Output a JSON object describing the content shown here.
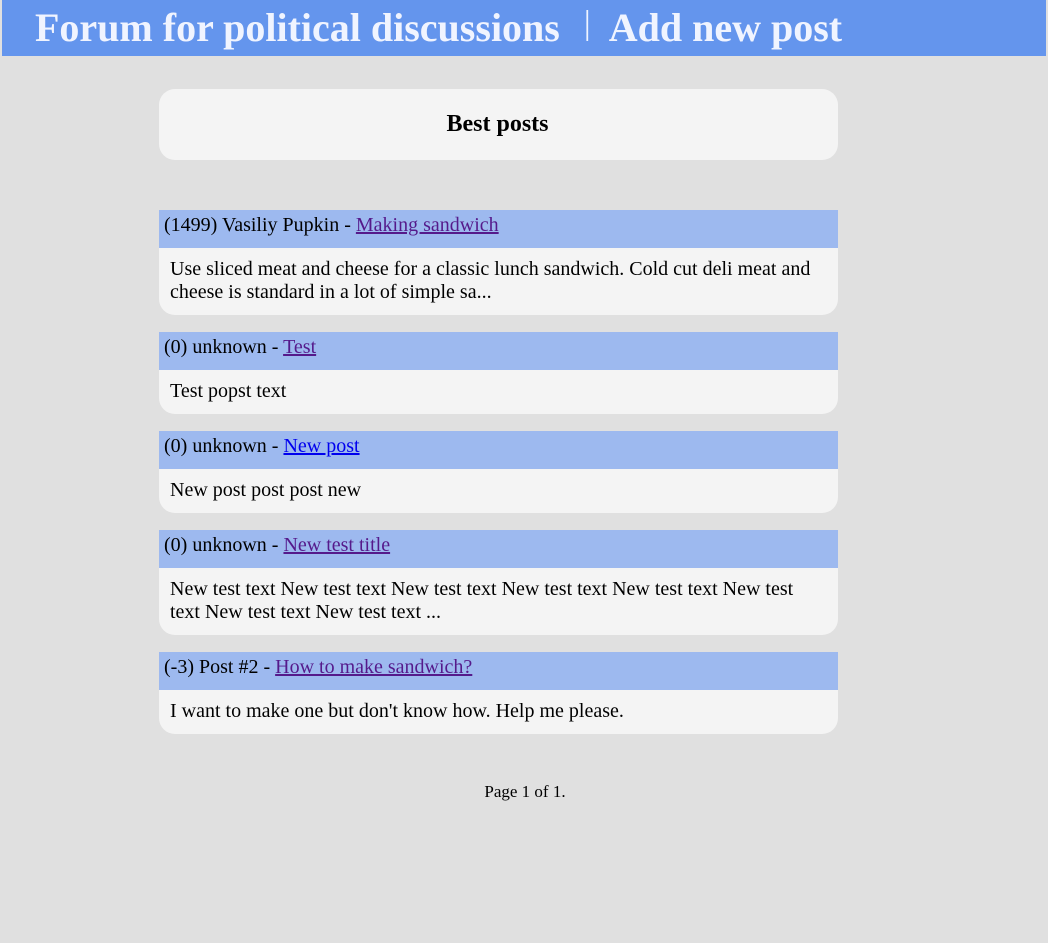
{
  "header": {
    "site_title": "Forum for political discussions",
    "separator": "|",
    "add_post": "Add new post"
  },
  "section": {
    "heading": "Best posts"
  },
  "posts": [
    {
      "score": "(1499)",
      "author": "Vasiliy Pupkin",
      "dash": "-",
      "title": "Making sandwich",
      "excerpt": "Use sliced meat and cheese for a classic lunch sandwich. Cold cut deli meat and cheese is standard in a lot of simple sa...",
      "visited": true
    },
    {
      "score": "(0)",
      "author": "unknown",
      "dash": "-",
      "title": "Test",
      "excerpt": "Test popst text",
      "visited": true
    },
    {
      "score": "(0)",
      "author": "unknown",
      "dash": "-",
      "title": "New post",
      "excerpt": "New post post post new",
      "visited": false
    },
    {
      "score": "(0)",
      "author": "unknown",
      "dash": "-",
      "title": "New test title",
      "excerpt": "New test text New test text New test text New test text New test text New test text New test text New test text ...",
      "visited": true
    },
    {
      "score": "(-3)",
      "author": "Post #2",
      "dash": "-",
      "title": "How to make sandwich?",
      "excerpt": "I want to make one but don't know how. Help me please.",
      "visited": true
    }
  ],
  "pagination": {
    "text": "Page 1 of 1."
  },
  "colors": {
    "header_bg": "#6495ed",
    "post_head_bg": "#9db9ef",
    "card_bg": "#f4f4f4",
    "page_bg": "#e0e0e0",
    "visited_link": "#551a8b",
    "unvisited_link": "#0000ee"
  }
}
